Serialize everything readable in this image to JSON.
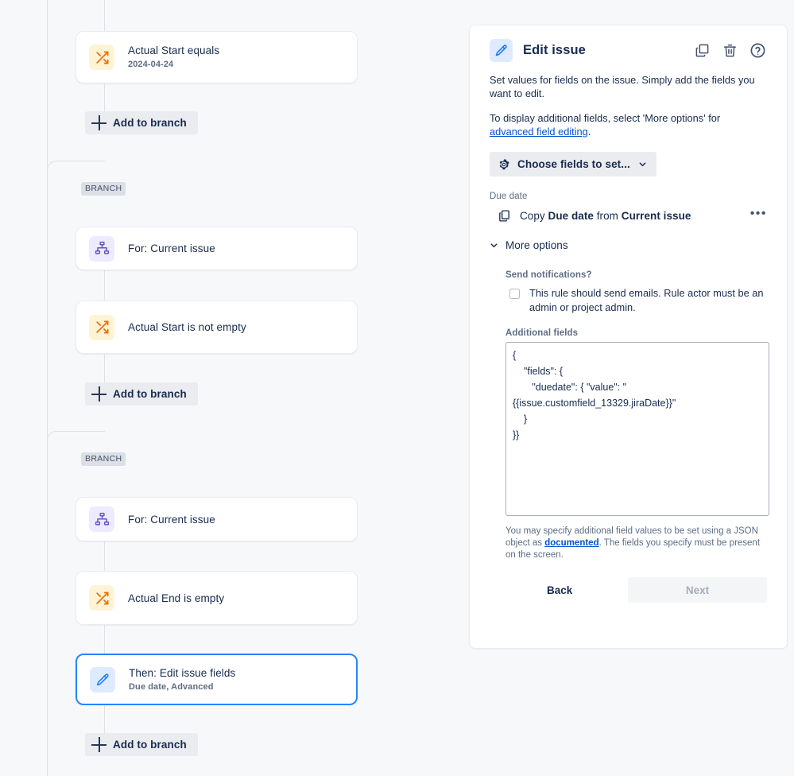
{
  "tree": {
    "nodes": [
      {
        "id": "actual-start-equals",
        "icon": "shuffle-icon",
        "title": "Actual Start equals",
        "subtitle": "2024-04-24",
        "selected": false
      },
      {
        "id": "for-current-issue-1",
        "icon": "branch-hierarchy-icon",
        "title": "For: Current issue",
        "subtitle": "",
        "selected": false
      },
      {
        "id": "actual-start-not-empty",
        "icon": "shuffle-icon",
        "title": "Actual Start is not empty",
        "subtitle": "",
        "selected": false
      },
      {
        "id": "for-current-issue-2",
        "icon": "branch-hierarchy-icon",
        "title": "For: Current issue",
        "subtitle": "",
        "selected": false
      },
      {
        "id": "actual-end-is-empty",
        "icon": "shuffle-icon",
        "title": "Actual End is empty",
        "subtitle": "",
        "selected": false
      },
      {
        "id": "then-edit-issue-fields",
        "icon": "edit-pencil-icon",
        "title": "Then: Edit issue fields",
        "subtitle": "Due date, Advanced",
        "selected": true
      }
    ],
    "branch_pill_label": "BRANCH",
    "add_to_branch_label": "Add to branch"
  },
  "panel": {
    "title": "Edit issue",
    "header_icons": [
      "duplicate-icon",
      "trash-icon",
      "help-circle-icon"
    ],
    "description_1": "Set values for fields on the issue. Simply add the fields you want to edit.",
    "description_2_pre": "To display additional fields, select 'More options' for ",
    "description_2_link": "advanced field editing",
    "description_2_post": ".",
    "choose_fields_label": "Choose fields to set...",
    "due_date_section_label": "Due date",
    "copy_row": {
      "pre": "Copy ",
      "bold_1": "Due date",
      "mid": " from ",
      "bold_2": "Current issue",
      "more_menu": "•••"
    },
    "more_options_label": "More options",
    "send_notifications_label": "Send notifications?",
    "send_notifications_checkbox_text": "This rule should send emails. Rule actor must be an admin or project admin.",
    "send_notifications_checked": false,
    "additional_fields_label": "Additional fields",
    "additional_fields_value": "{\n    \"fields\": {\n       \"duedate\": { \"value\": \"\n{{issue.customfield_13329.jiraDate}}\"\n    }\n}}",
    "help_text_pre": "You may specify additional field values to be set using a JSON object as ",
    "help_text_link": "documented",
    "help_text_post": ". The fields you specify must be present on the screen.",
    "back_label": "Back",
    "next_label": "Next",
    "next_disabled": true
  },
  "colors": {
    "page_background": "#f7f8fa",
    "accent_blue": "#2684ff",
    "link_blue": "#0052cc",
    "condition_icon": "#e8700a",
    "branch_icon": "#6554c0",
    "edit_icon": "#1d7afc",
    "text_primary": "#172b4d",
    "text_subtle": "#5e6c84"
  }
}
